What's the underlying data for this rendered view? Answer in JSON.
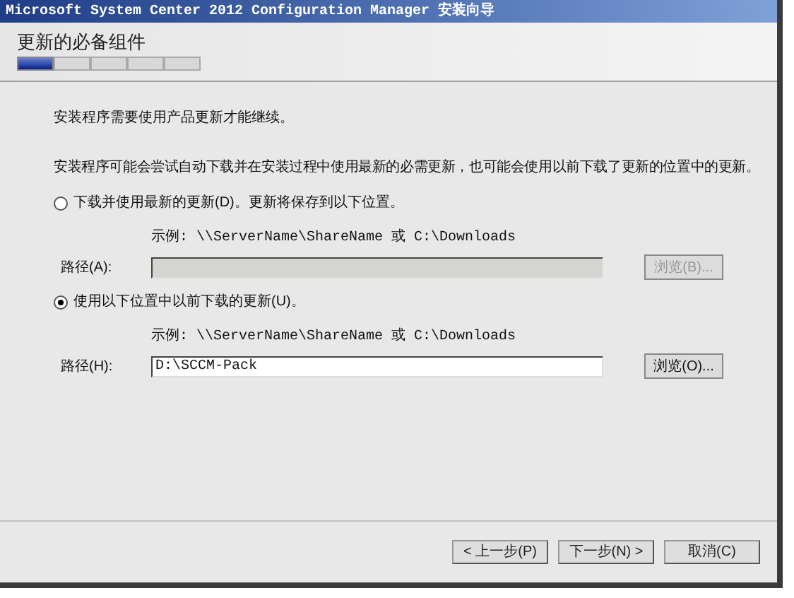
{
  "window": {
    "title": "Microsoft System Center 2012 Configuration Manager 安装向导"
  },
  "page_title": "更新的必备组件",
  "steps": [
    {
      "selected": true
    },
    {
      "selected": false
    },
    {
      "selected": false
    },
    {
      "selected": false
    },
    {
      "selected": false
    }
  ],
  "intro": "安装程序需要使用产品更新才能继续。",
  "description": "安装程序可能会尝试自动下载并在安装过程中使用最新的必需更新，也可能会使用以前下载了更新的位置中的更新。",
  "options": [
    {
      "label": "下载并使用最新的更新(D)。更新将保存到以下位置。",
      "selected": false,
      "example": "示例: \\\\ServerName\\ShareName 或 C:\\Downloads",
      "path_label": "路径(A):",
      "disabled": true,
      "browse_label": "浏览(B)..."
    },
    {
      "label": "使用以下位置中以前下载的更新(U)。",
      "selected": true,
      "example": "示例: \\\\ServerName\\ShareName 或 C:\\Downloads",
      "path_label": "路径(H):",
      "path_value": "D:\\SCCM-Pack",
      "disabled": false,
      "browse_label": "浏览(O)..."
    }
  ],
  "buttons": [
    {
      "label": "< 上一步(P)"
    },
    {
      "label": "下一步(N) >"
    },
    {
      "label": "取消(C)"
    }
  ]
}
